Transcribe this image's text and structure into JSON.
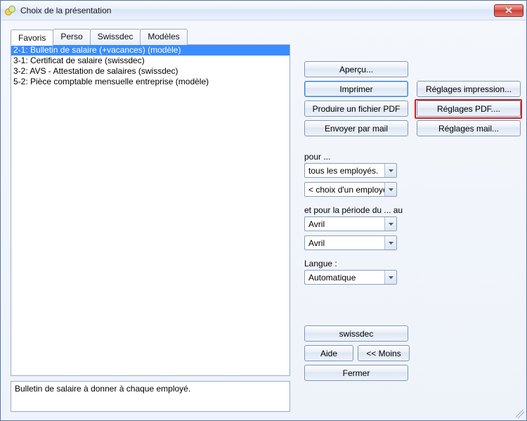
{
  "window": {
    "title": "Choix de la présentation"
  },
  "tabs": [
    "Favoris",
    "Perso",
    "Swissdec",
    "Modèles"
  ],
  "active_tab_index": 0,
  "list": [
    "2-1: Bulletin de salaire (+vacances) (modèle)",
    "3-1: Certificat de salaire (swissdec)",
    "3-2: AVS - Attestation de salaires (swissdec)",
    "5-2: Pièce comptable mensuelle entreprise (modèle)"
  ],
  "selected_index": 0,
  "buttons": {
    "apercu": "Aperçu...",
    "imprimer": "Imprimer",
    "produire_pdf": "Produire un fichier PDF",
    "envoyer_mail": "Envoyer par mail",
    "reglages_impression": "Réglages impression...",
    "reglages_pdf": "Réglages PDF....",
    "reglages_mail": "Réglages mail...",
    "swissdec": "swissdec",
    "aide": "Aide",
    "moins": " <<  Moins",
    "fermer": "Fermer"
  },
  "labels": {
    "pour": "pour ...",
    "periode": "et pour la période du ... au",
    "langue": "Langue :"
  },
  "dropdowns": {
    "pour1": "tous les employés.",
    "pour2": "< choix d'un employé >",
    "periode_from": "Avril",
    "periode_to": "Avril",
    "langue": "Automatique"
  },
  "description": "Bulletin de salaire à donner à chaque employé."
}
